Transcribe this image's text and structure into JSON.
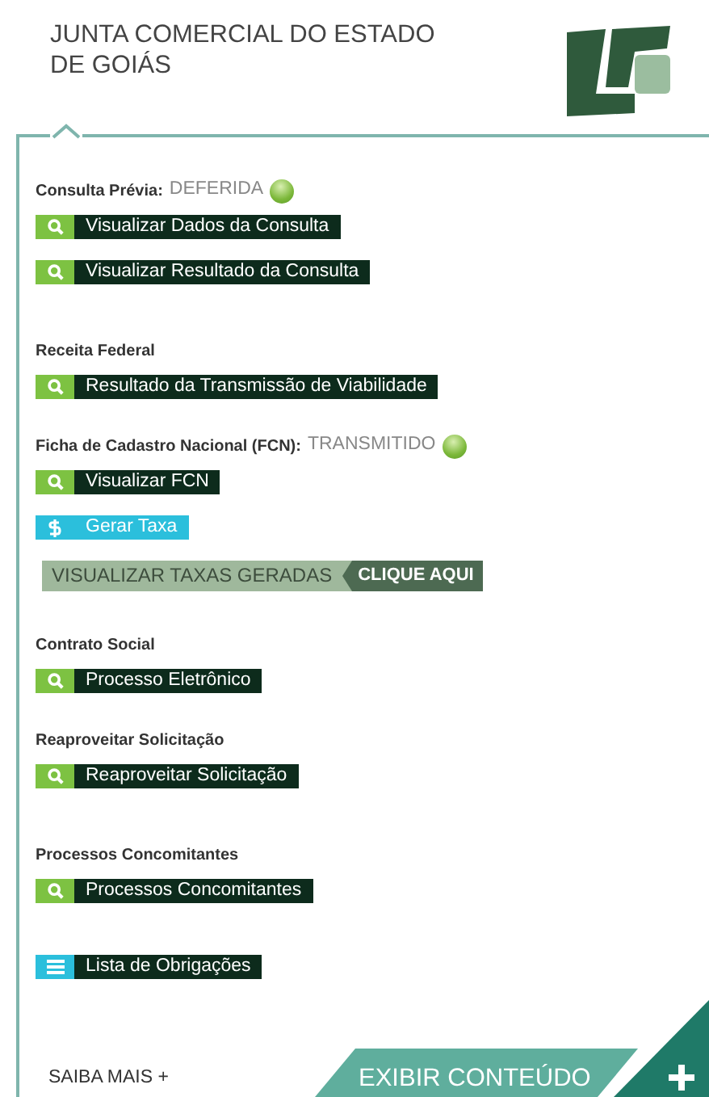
{
  "header": {
    "title": "JUNTA COMERCIAL DO ESTADO DE GOIÁS"
  },
  "sections": [
    {
      "title": "Consulta Prévia:",
      "status": "DEFERIDA",
      "buttons": [
        {
          "kind": "search",
          "label": "Visualizar Dados da Consulta"
        },
        {
          "kind": "search",
          "label": "Visualizar Resultado da Consulta"
        }
      ]
    },
    {
      "title": "Receita Federal",
      "buttons": [
        {
          "kind": "search",
          "label": "Resultado da Transmissão de Viabilidade"
        }
      ]
    },
    {
      "title": "Ficha de Cadastro Nacional (FCN):",
      "status": "TRANSMITIDO",
      "buttons": [
        {
          "kind": "search",
          "label": "Visualizar FCN"
        },
        {
          "kind": "money",
          "label": "Gerar Taxa"
        }
      ],
      "banner": {
        "label": "VISUALIZAR TAXAS GERADAS",
        "action": "CLIQUE AQUI"
      }
    },
    {
      "title": "Contrato Social",
      "buttons": [
        {
          "kind": "search",
          "label": "Processo Eletrônico"
        }
      ]
    },
    {
      "title": "Reaproveitar Solicitação",
      "buttons": [
        {
          "kind": "search",
          "label": "Reaproveitar Solicitação"
        }
      ]
    },
    {
      "title": "Processos Concomitantes",
      "buttons": [
        {
          "kind": "search",
          "label": "Processos Concomitantes"
        }
      ]
    },
    {
      "buttons": [
        {
          "kind": "list",
          "label": "Lista de Obrigações"
        }
      ]
    }
  ],
  "footer": {
    "more": "SAIBA MAIS +",
    "expand": "EXIBIR CONTEÚDO"
  }
}
